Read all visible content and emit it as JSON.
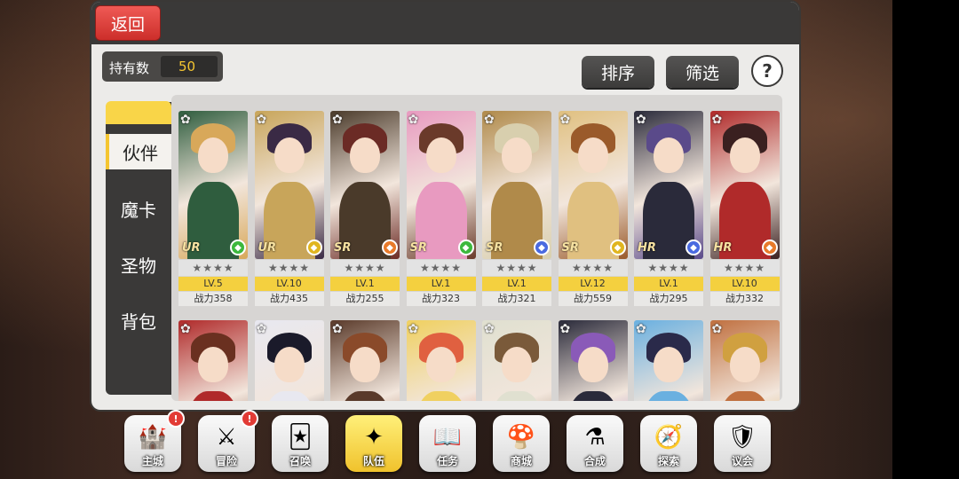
{
  "header": {
    "back_label": "返回"
  },
  "owned": {
    "label": "持有数",
    "value": "50"
  },
  "toolbar": {
    "sort_label": "排序",
    "filter_label": "筛选",
    "help_label": "?"
  },
  "tabs": [
    {
      "label": "伙伴",
      "active": true
    },
    {
      "label": "魔卡",
      "active": false
    },
    {
      "label": "圣物",
      "active": false
    },
    {
      "label": "背包",
      "active": false
    }
  ],
  "cards_row1": [
    {
      "rarity": "UR",
      "stars": "★★★★",
      "level": "LV.5",
      "power": "战力358",
      "elem_color": "#3db83d",
      "hair": "#d8a85a",
      "outfit": "#2f5d3e"
    },
    {
      "rarity": "UR",
      "stars": "★★★★",
      "level": "LV.10",
      "power": "战力435",
      "elem_color": "#e0b520",
      "hair": "#3a2a45",
      "outfit": "#c8a55a"
    },
    {
      "rarity": "SR",
      "stars": "★★★★",
      "level": "LV.1",
      "power": "战力255",
      "elem_color": "#e87a2a",
      "hair": "#6b2b25",
      "outfit": "#4a3a2a"
    },
    {
      "rarity": "SR",
      "stars": "★★★★",
      "level": "LV.1",
      "power": "战力323",
      "elem_color": "#3db83d",
      "hair": "#6a3a2a",
      "outfit": "#e89ac0"
    },
    {
      "rarity": "SR",
      "stars": "★★★★",
      "level": "LV.1",
      "power": "战力321",
      "elem_color": "#4a6ae0",
      "hair": "#d8cfae",
      "outfit": "#b08a4a"
    },
    {
      "rarity": "SR",
      "stars": "★★★★",
      "level": "LV.12",
      "power": "战力559",
      "elem_color": "#e0b520",
      "hair": "#9a5a2a",
      "outfit": "#e0c080"
    },
    {
      "rarity": "HR",
      "stars": "★★★★",
      "level": "LV.1",
      "power": "战力295",
      "elem_color": "#4a6ae0",
      "hair": "#5a4a8a",
      "outfit": "#2a2a3a"
    },
    {
      "rarity": "HR",
      "stars": "★★★★",
      "level": "LV.10",
      "power": "战力332",
      "elem_color": "#e87a2a",
      "hair": "#3a2020",
      "outfit": "#b02a2a"
    }
  ],
  "cards_row2": [
    {
      "hair": "#6a3020",
      "outfit": "#b02a2a"
    },
    {
      "hair": "#1a1a2a",
      "outfit": "#e8e8f0"
    },
    {
      "hair": "#8a4a2a",
      "outfit": "#5a3a2a"
    },
    {
      "hair": "#e06040",
      "outfit": "#f0d060"
    },
    {
      "hair": "#7a5a3a",
      "outfit": "#e0e0d0"
    },
    {
      "hair": "#8a5ab8",
      "outfit": "#2a2a3a"
    },
    {
      "hair": "#2a2a4a",
      "outfit": "#6ab0e0"
    },
    {
      "hair": "#d0a040",
      "outfit": "#c07040"
    }
  ],
  "bottom_nav": [
    {
      "label": "主城",
      "icon": "🏰",
      "badge": "!",
      "active": false
    },
    {
      "label": "冒险",
      "icon": "⚔",
      "badge": "!",
      "active": false
    },
    {
      "label": "召唤",
      "icon": "🃏",
      "badge": "",
      "active": false
    },
    {
      "label": "队伍",
      "icon": "✦",
      "badge": "",
      "active": true
    },
    {
      "label": "任务",
      "icon": "📖",
      "badge": "",
      "active": false
    },
    {
      "label": "商城",
      "icon": "🍄",
      "badge": "",
      "active": false
    },
    {
      "label": "合成",
      "icon": "⚗",
      "badge": "",
      "active": false
    },
    {
      "label": "探索",
      "icon": "🧭",
      "badge": "",
      "active": false
    },
    {
      "label": "议会",
      "icon": "🛡",
      "badge": "",
      "active": false
    }
  ]
}
